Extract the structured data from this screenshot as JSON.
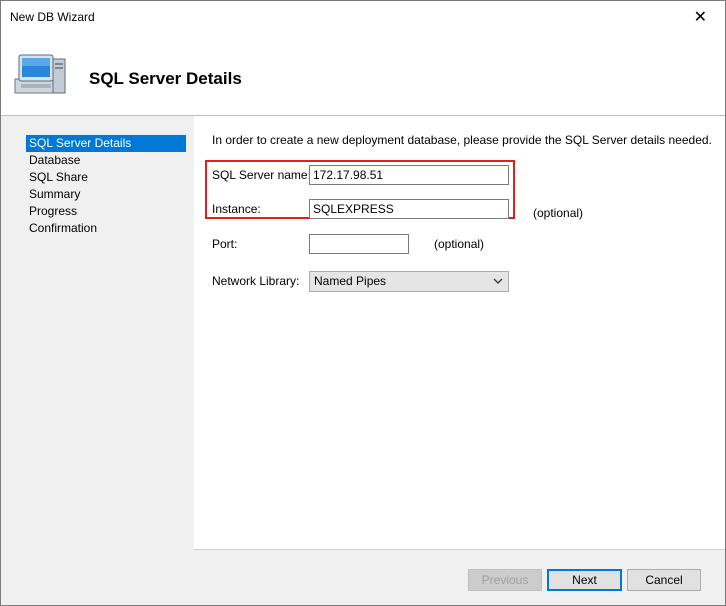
{
  "window": {
    "title": "New DB Wizard",
    "close_glyph": "✕"
  },
  "header": {
    "title": "SQL Server Details",
    "icon": "computer-icon"
  },
  "steps": [
    {
      "label": "SQL Server Details",
      "active": true
    },
    {
      "label": "Database",
      "active": false
    },
    {
      "label": "SQL Share",
      "active": false
    },
    {
      "label": "Summary",
      "active": false
    },
    {
      "label": "Progress",
      "active": false
    },
    {
      "label": "Confirmation",
      "active": false
    }
  ],
  "form": {
    "intro": "In order to create a new deployment database, please provide the SQL Server details needed.",
    "server_name_label": "SQL Server name:",
    "server_name_value": "172.17.98.51",
    "instance_label": "Instance:",
    "instance_value": "SQLEXPRESS",
    "instance_optional": "(optional)",
    "port_label": "Port:",
    "port_value": "",
    "port_optional": "(optional)",
    "network_library_label": "Network Library:",
    "network_library_value": "Named Pipes",
    "highlight_color": "#e02020"
  },
  "buttons": {
    "previous": "Previous",
    "next": "Next",
    "cancel": "Cancel"
  },
  "colors": {
    "accent": "#0078d7"
  }
}
